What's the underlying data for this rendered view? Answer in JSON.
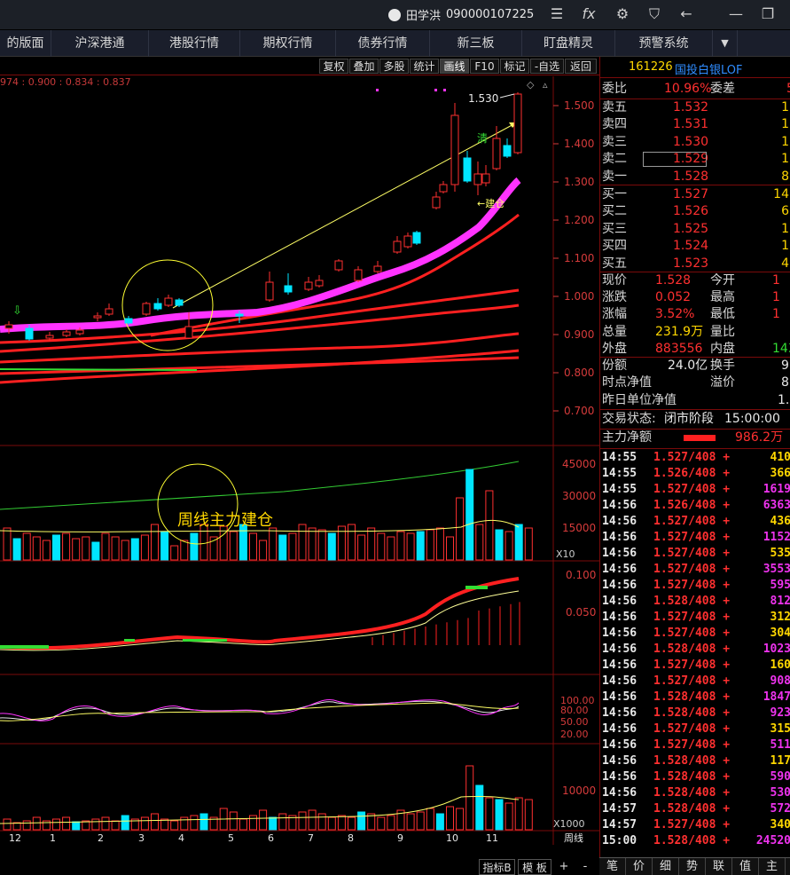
{
  "titlebar": {
    "user_name": "田学洪",
    "account": "090000107225",
    "icons": [
      "menu-icon",
      "fx-icon",
      "settings-icon",
      "shirt-icon",
      "back-arrow-icon",
      "minimize-icon",
      "restore-icon"
    ]
  },
  "menu": {
    "items": [
      "的版面",
      "沪深港通",
      "港股行情",
      "期权行情",
      "债券行情",
      "新三板",
      "盯盘精灵",
      "预警系统"
    ],
    "more_icon": "dropdown-arrow-icon"
  },
  "toolbar": {
    "buttons": [
      "复权",
      "叠加",
      "多股",
      "统计",
      "画线",
      "F10",
      "标记",
      "-自选",
      "返回"
    ],
    "active": "画线"
  },
  "price_info": "974 : 0.900 : 0.834 : 0.837",
  "main_chart": {
    "y_ticks": [
      "1.500",
      "1.400",
      "1.300",
      "1.200",
      "1.100",
      "1.000",
      "0.900",
      "0.800",
      "0.700"
    ],
    "high_label": "1.530",
    "annotation_clear": "清",
    "annotation_build": "←建仓"
  },
  "volume_chart": {
    "y_ticks": [
      "45000",
      "30000",
      "15000"
    ],
    "unit": "X10",
    "annotation": "周线主力建仓"
  },
  "macd_chart": {
    "y_ticks": [
      "0.100",
      "0.050"
    ]
  },
  "kdj_chart": {
    "y_ticks": [
      "100.00",
      "80.00",
      "50.00",
      "20.00"
    ]
  },
  "vol2_chart": {
    "y_ticks": [
      "10000"
    ],
    "unit": "X1000"
  },
  "x_axis": {
    "labels": [
      "12",
      "1",
      "2",
      "3",
      "4",
      "5",
      "6",
      "7",
      "8",
      "9",
      "10",
      "11"
    ],
    "period": "周线"
  },
  "bottom_bar": {
    "indicator": "指标B",
    "template": "模 板",
    "plus": "+",
    "minus": "-"
  },
  "quote": {
    "code": "161226",
    "name": "国投白银LOF",
    "weibi_label": "委比",
    "weibi_value": "10.96%",
    "weicha_label": "委差",
    "weicha_value": "5",
    "asks": [
      {
        "label": "卖五",
        "price": "1.532",
        "vol": "1"
      },
      {
        "label": "卖四",
        "price": "1.531",
        "vol": "1"
      },
      {
        "label": "卖三",
        "price": "1.530",
        "vol": "1"
      },
      {
        "label": "卖二",
        "price": "1.529",
        "vol": "1"
      },
      {
        "label": "卖一",
        "price": "1.528",
        "vol": "8"
      }
    ],
    "bids": [
      {
        "label": "买一",
        "price": "1.527",
        "vol": "14"
      },
      {
        "label": "买二",
        "price": "1.526",
        "vol": "6"
      },
      {
        "label": "买三",
        "price": "1.525",
        "vol": "1"
      },
      {
        "label": "买四",
        "price": "1.524",
        "vol": "1"
      },
      {
        "label": "买五",
        "price": "1.523",
        "vol": "4"
      }
    ],
    "stats": [
      {
        "l1": "现价",
        "v1": "1.528",
        "l2": "今开",
        "v2": "1"
      },
      {
        "l1": "涨跌",
        "v1": "0.052",
        "l2": "最高",
        "v2": "1"
      },
      {
        "l1": "涨幅",
        "v1": "3.52%",
        "l2": "最低",
        "v2": "1"
      },
      {
        "l1": "总量",
        "v1": "231.9万",
        "l2": "量比",
        "v2": ""
      },
      {
        "l1": "外盘",
        "v1": "883556",
        "l2": "内盘",
        "v2": "143"
      }
    ],
    "extra": [
      {
        "l1": "份额",
        "v1": "24.0亿",
        "l2": "换手",
        "v2": "9."
      },
      {
        "l1": "时点净值",
        "v1": "",
        "l2": "溢价",
        "v2": "8"
      },
      {
        "l1": "昨日单位净值",
        "v1": "1.4",
        "l2": "",
        "v2": ""
      }
    ],
    "trade_status_label": "交易状态:",
    "trade_status": "闭市阶段",
    "trade_time": "15:00:00",
    "main_net_label": "主力净额",
    "main_net_value": "986.2万",
    "ticks": [
      {
        "t": "14:55",
        "p": "1.527/408 +",
        "v": "410",
        "c": "yellow"
      },
      {
        "t": "14:55",
        "p": "1.526/408 +",
        "v": "366",
        "c": "yellow"
      },
      {
        "t": "14:55",
        "p": "1.527/408 +",
        "v": "1619",
        "c": "purple"
      },
      {
        "t": "14:56",
        "p": "1.526/408 +",
        "v": "6363",
        "c": "purple"
      },
      {
        "t": "14:56",
        "p": "1.527/408 +",
        "v": "436",
        "c": "yellow"
      },
      {
        "t": "14:56",
        "p": "1.527/408 +",
        "v": "1152",
        "c": "purple"
      },
      {
        "t": "14:56",
        "p": "1.527/408 +",
        "v": "535",
        "c": "yellow"
      },
      {
        "t": "14:56",
        "p": "1.527/408 +",
        "v": "3553",
        "c": "purple"
      },
      {
        "t": "14:56",
        "p": "1.527/408 +",
        "v": "595",
        "c": "purple"
      },
      {
        "t": "14:56",
        "p": "1.528/408 +",
        "v": "812",
        "c": "purple"
      },
      {
        "t": "14:56",
        "p": "1.527/408 +",
        "v": "312",
        "c": "yellow"
      },
      {
        "t": "14:56",
        "p": "1.527/408 +",
        "v": "304",
        "c": "yellow"
      },
      {
        "t": "14:56",
        "p": "1.528/408 +",
        "v": "1023",
        "c": "purple"
      },
      {
        "t": "14:56",
        "p": "1.527/408 +",
        "v": "160",
        "c": "yellow"
      },
      {
        "t": "14:56",
        "p": "1.527/408 +",
        "v": "908",
        "c": "purple"
      },
      {
        "t": "14:56",
        "p": "1.528/408 +",
        "v": "1847",
        "c": "purple"
      },
      {
        "t": "14:56",
        "p": "1.528/408 +",
        "v": "923",
        "c": "purple"
      },
      {
        "t": "14:56",
        "p": "1.527/408 +",
        "v": "315",
        "c": "yellow"
      },
      {
        "t": "14:56",
        "p": "1.527/408 +",
        "v": "511",
        "c": "purple"
      },
      {
        "t": "14:56",
        "p": "1.528/408 +",
        "v": "117",
        "c": "yellow"
      },
      {
        "t": "14:56",
        "p": "1.528/408 +",
        "v": "590",
        "c": "purple"
      },
      {
        "t": "14:56",
        "p": "1.528/408 +",
        "v": "530",
        "c": "purple"
      },
      {
        "t": "14:57",
        "p": "1.528/408 +",
        "v": "572",
        "c": "purple"
      },
      {
        "t": "14:57",
        "p": "1.527/408 +",
        "v": "340",
        "c": "yellow"
      },
      {
        "t": "15:00",
        "p": "1.528/408 +",
        "v": "24520",
        "c": "purple"
      }
    ],
    "bottom_tabs": [
      "笔",
      "价",
      "细",
      "势",
      "联",
      "值",
      "主"
    ]
  },
  "colors": {
    "up": "#ff3030",
    "down": "#00e5ff",
    "ma_fast": "#ff33ff",
    "ma_slow": "#ff2020",
    "grid": "#7a0a0a"
  }
}
